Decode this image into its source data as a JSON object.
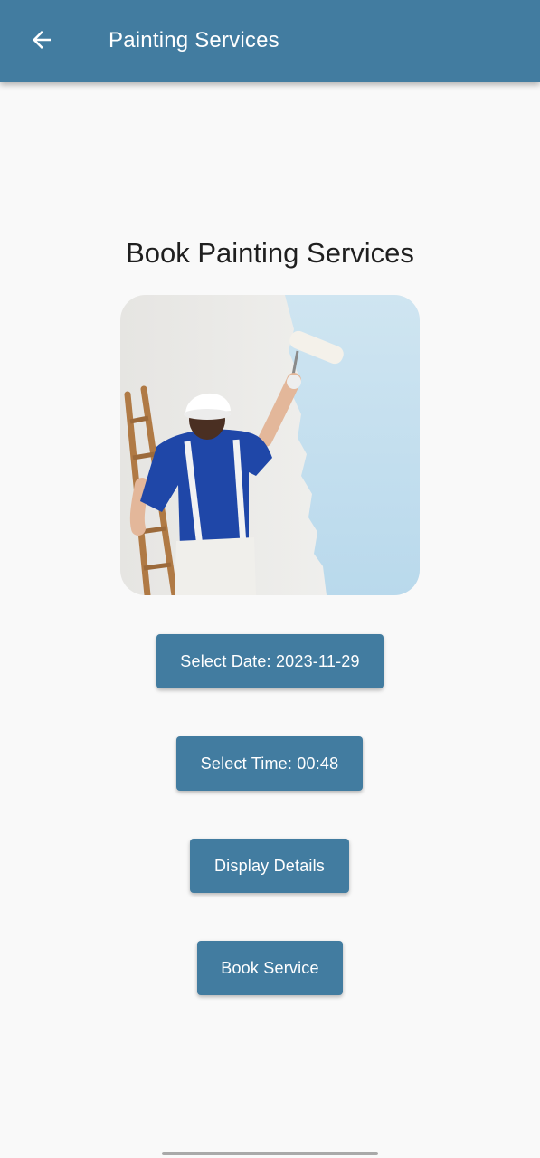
{
  "appbar": {
    "title": "Painting Services",
    "back_icon": "arrow-left-icon",
    "background_color": "#427ca0"
  },
  "main": {
    "heading": "Book Painting Services",
    "image_icon": "painter-rolling-wall-photo"
  },
  "buttons": {
    "select_date": "Select Date: 2023-11-29",
    "select_time": "Select Time: 00:48",
    "display_details": "Display Details",
    "book_service": "Book Service"
  },
  "colors": {
    "accent": "#427ca0",
    "background": "#f9f9f9",
    "heading_text": "#1f1f1f"
  }
}
